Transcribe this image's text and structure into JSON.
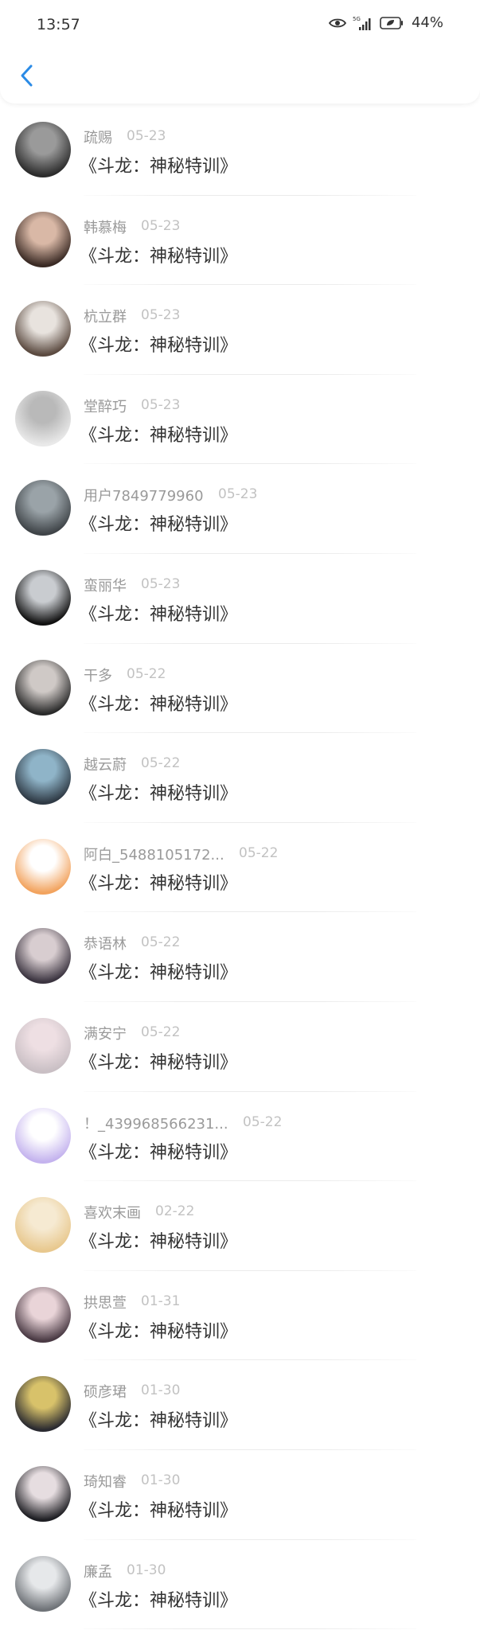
{
  "status_bar": {
    "time": "13:57",
    "network": "5G",
    "battery": "44%"
  },
  "header": {
    "back_icon": "chevron-left-icon",
    "accent_color": "#2b8be6"
  },
  "items": [
    {
      "name": "疏赐",
      "date": "05-23",
      "title": "《斗龙：神秘特训》",
      "avatar_colors": [
        "#2c2c2c",
        "#9a9a9a"
      ]
    },
    {
      "name": "韩慕梅",
      "date": "05-23",
      "title": "《斗龙：神秘特训》",
      "avatar_colors": [
        "#3a2a24",
        "#d9b8a6"
      ]
    },
    {
      "name": "杭立群",
      "date": "05-23",
      "title": "《斗龙：神秘特训》",
      "avatar_colors": [
        "#5b4a40",
        "#e8e3de"
      ]
    },
    {
      "name": "堂醉巧",
      "date": "05-23",
      "title": "《斗龙：神秘特训》",
      "avatar_colors": [
        "#e9e9e9",
        "#b9b9b9"
      ]
    },
    {
      "name": "用户7849779960",
      "date": "05-23",
      "title": "《斗龙：神秘特训》",
      "avatar_colors": [
        "#3f4448",
        "#9aa3a8"
      ]
    },
    {
      "name": "蛮丽华",
      "date": "05-23",
      "title": "《斗龙：神秘特训》",
      "avatar_colors": [
        "#111111",
        "#c9ccd0"
      ]
    },
    {
      "name": "干多",
      "date": "05-22",
      "title": "《斗龙：神秘特训》",
      "avatar_colors": [
        "#2a2a2a",
        "#cfc9c6"
      ]
    },
    {
      "name": "越云蔚",
      "date": "05-22",
      "title": "《斗龙：神秘特训》",
      "avatar_colors": [
        "#2f3a45",
        "#8fb4c8"
      ]
    },
    {
      "name": "阿白_5488105172...",
      "date": "05-22",
      "title": "《斗龙：神秘特训》",
      "avatar_colors": [
        "#f2a35e",
        "#ffffff"
      ]
    },
    {
      "name": "恭语林",
      "date": "05-22",
      "title": "《斗龙：神秘特训》",
      "avatar_colors": [
        "#3b3440",
        "#d8cdd0"
      ]
    },
    {
      "name": "满安宁",
      "date": "05-22",
      "title": "《斗龙：神秘特训》",
      "avatar_colors": [
        "#c9bfc4",
        "#eedfe3"
      ]
    },
    {
      "name": "！_439968566231...",
      "date": "05-22",
      "title": "《斗龙：神秘特训》",
      "avatar_colors": [
        "#c4b3ee",
        "#ffffff"
      ]
    },
    {
      "name": "喜欢末画",
      "date": "02-22",
      "title": "《斗龙：神秘特训》",
      "avatar_colors": [
        "#e8c88e",
        "#f6ead2"
      ]
    },
    {
      "name": "拱思萱",
      "date": "01-31",
      "title": "《斗龙：神秘特训》",
      "avatar_colors": [
        "#4a3a44",
        "#e9d4d8"
      ]
    },
    {
      "name": "硕彦珺",
      "date": "01-30",
      "title": "《斗龙：神秘特训》",
      "avatar_colors": [
        "#2a2a30",
        "#d8c26a"
      ]
    },
    {
      "name": "琦知睿",
      "date": "01-30",
      "title": "《斗龙：神秘特训》",
      "avatar_colors": [
        "#1f1f24",
        "#e6dde0"
      ]
    },
    {
      "name": "廉孟",
      "date": "01-30",
      "title": "《斗龙：神秘特训》",
      "avatar_colors": [
        "#6f7378",
        "#e6e8ea"
      ]
    }
  ]
}
